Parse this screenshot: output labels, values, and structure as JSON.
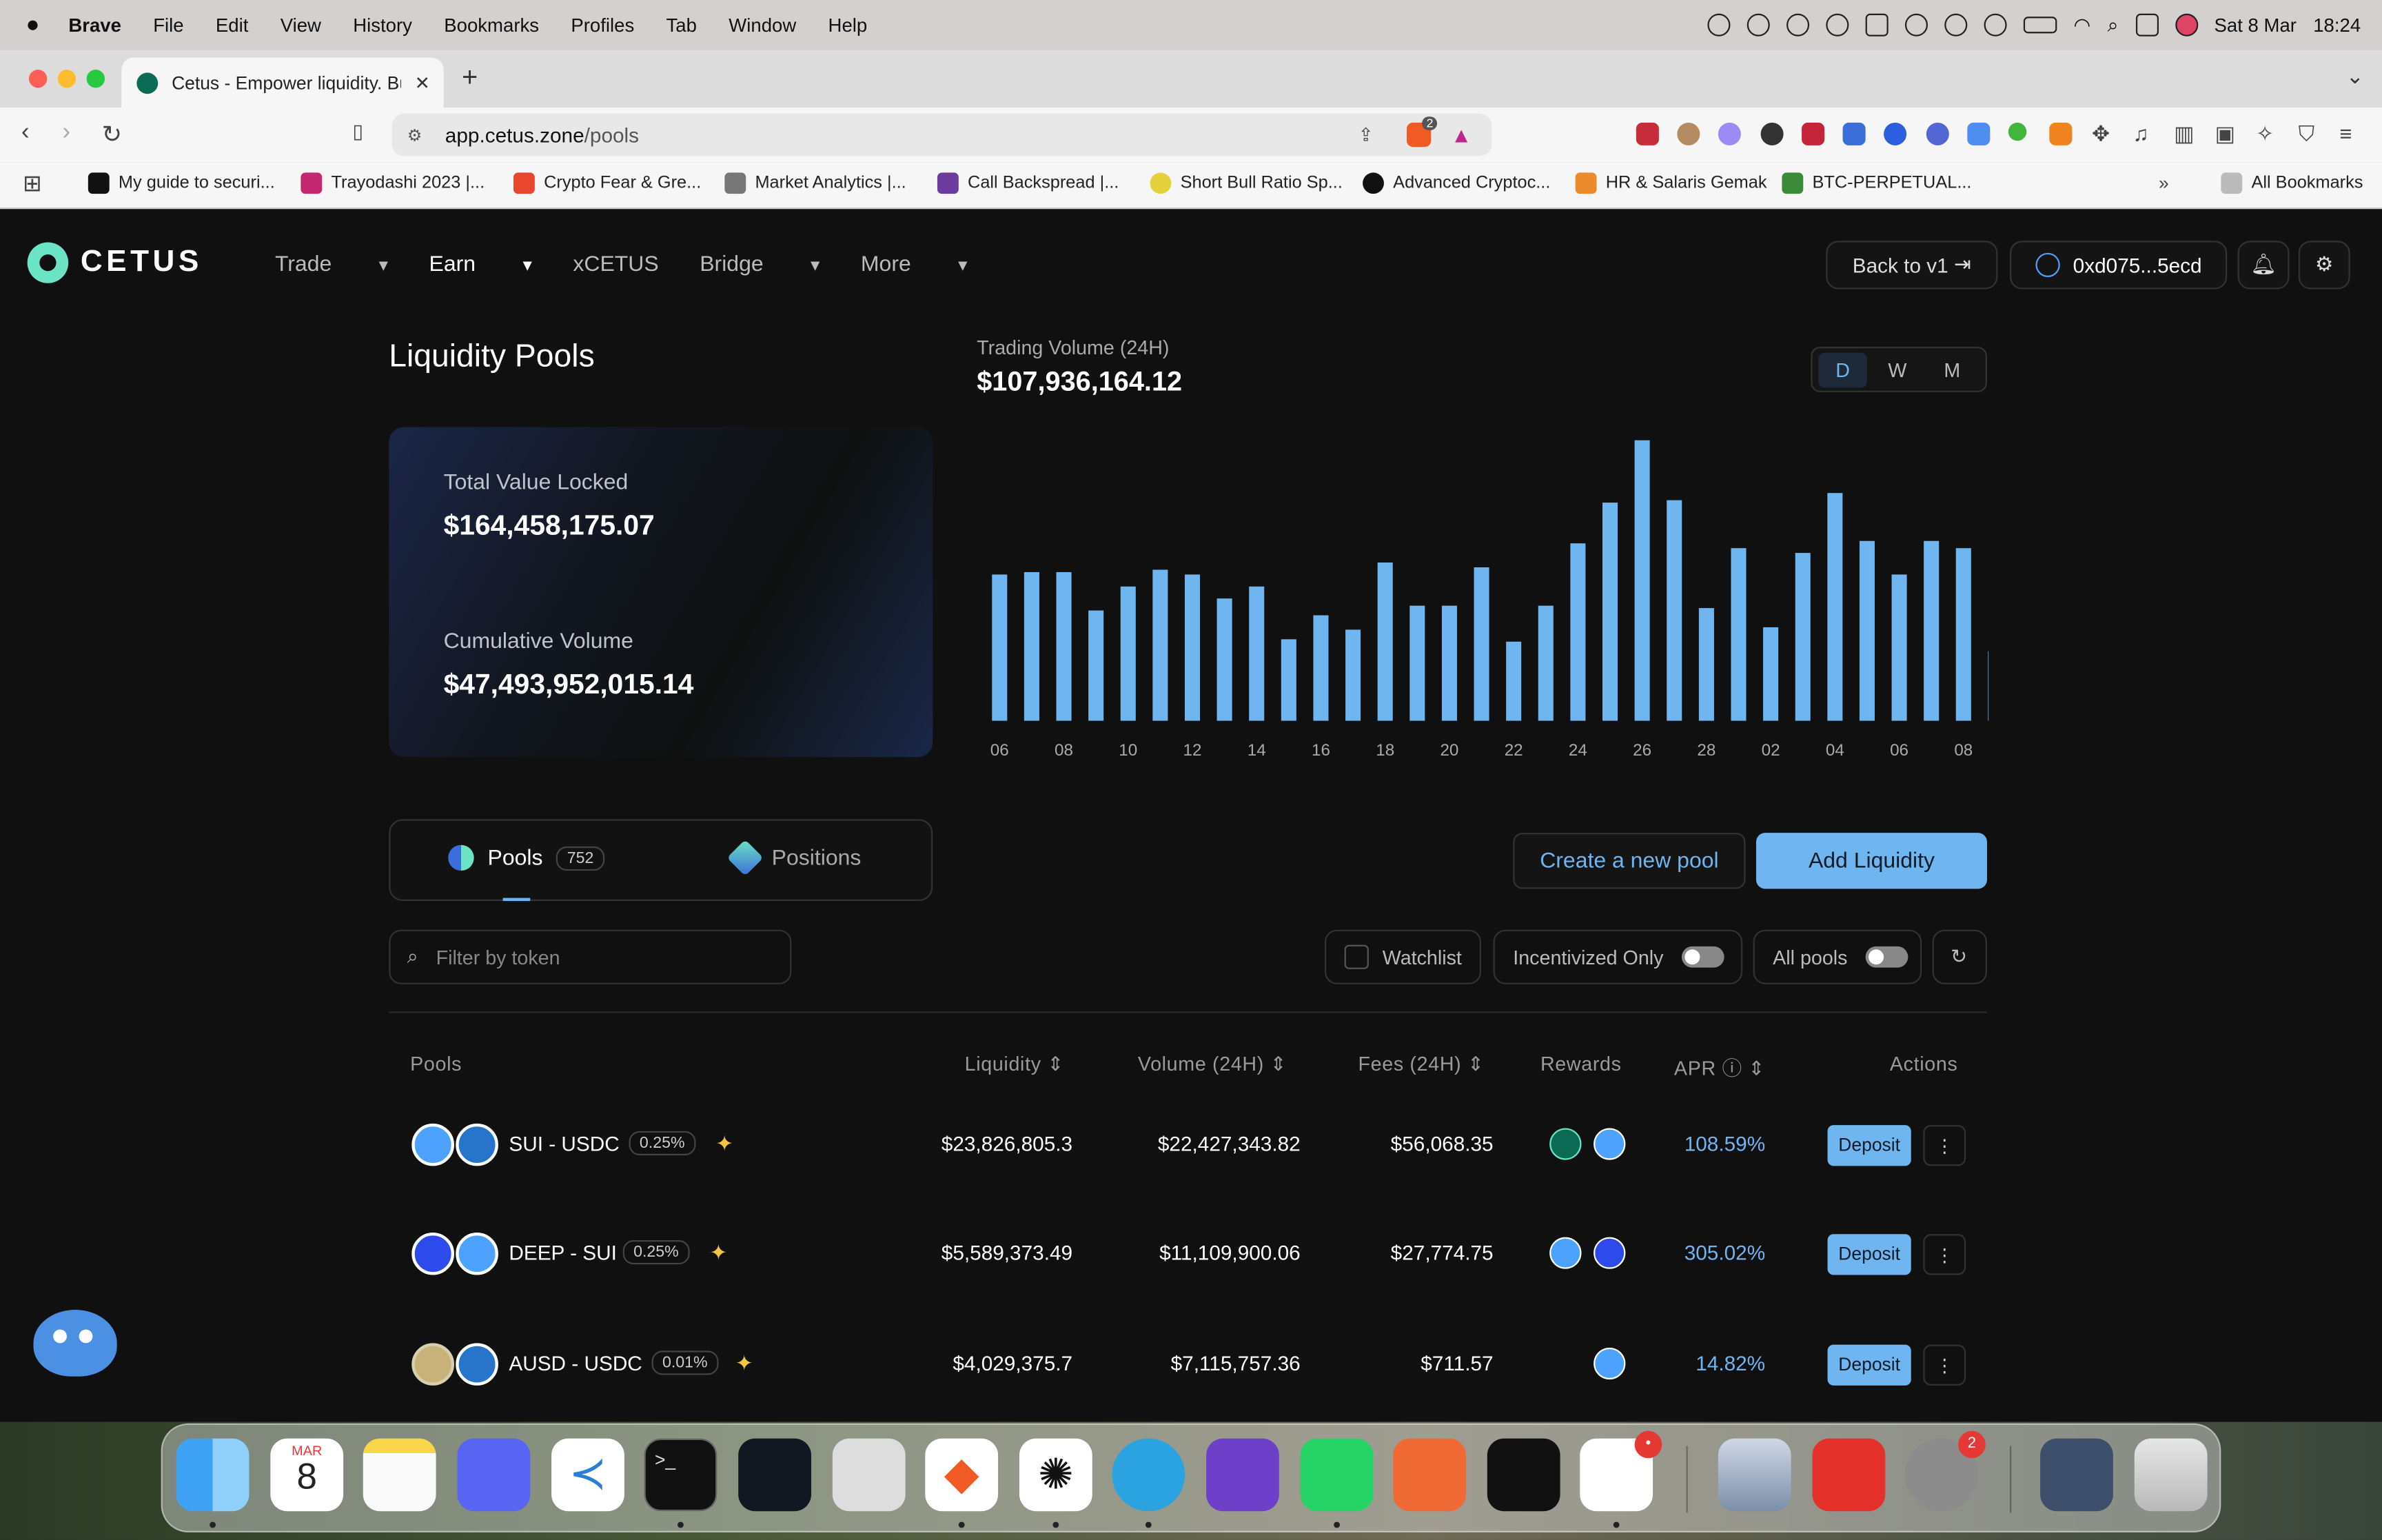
{
  "menubar": {
    "browser": "Brave",
    "items": [
      "File",
      "Edit",
      "View",
      "History",
      "Bookmarks",
      "Profiles",
      "Tab",
      "Window",
      "Help"
    ],
    "date": "Sat 8 Mar",
    "time": "18:24"
  },
  "browser": {
    "tab_title": "Cetus - Empower liquidity. Bu",
    "url_domain": "app.cetus.zone",
    "url_path": "/pools",
    "shield_count": "2",
    "bookmarks": [
      "My guide to securi...",
      "Trayodashi 2023 |...",
      "Crypto Fear & Gre...",
      "Market Analytics |...",
      "Call Backspread |...",
      "Short Bull Ratio Sp...",
      "Advanced Cryptoc...",
      "HR & Salaris Gemak",
      "BTC-PERPETUAL..."
    ],
    "all_bookmarks": "All Bookmarks"
  },
  "nav": {
    "logo": "CETUS",
    "items": [
      "Trade",
      "Earn",
      "xCETUS",
      "Bridge",
      "More"
    ],
    "back_v1": "Back to v1",
    "wallet": "0xd075...5ecd"
  },
  "page": {
    "title": "Liquidity Pools",
    "tvl_label": "Total Value Locked",
    "tvl_value": "$164,458,175.07",
    "cum_label": "Cumulative Volume",
    "cum_value": "$47,493,952,015.14"
  },
  "volume": {
    "label": "Trading Volume (24H)",
    "value": "$107,936,164.12",
    "periods": [
      "D",
      "W",
      "M"
    ],
    "active_period": "D"
  },
  "chart_data": {
    "type": "bar",
    "x_ticks": [
      "06",
      "08",
      "10",
      "12",
      "14",
      "16",
      "18",
      "20",
      "22",
      "24",
      "26",
      "28",
      "02",
      "04",
      "06",
      "08"
    ],
    "values": [
      61,
      62,
      62,
      46,
      56,
      63,
      61,
      51,
      56,
      34,
      44,
      38,
      66,
      48,
      48,
      64,
      33,
      48,
      74,
      91,
      117,
      92,
      47,
      72,
      39,
      70,
      95,
      75,
      61,
      75,
      72,
      29
    ],
    "color": "#6fb6f1",
    "ylim": [
      0,
      120
    ]
  },
  "tabs": {
    "pools": "Pools",
    "pools_count": "752",
    "positions": "Positions"
  },
  "actions": {
    "create_pool": "Create a new pool",
    "add_liquidity": "Add Liquidity"
  },
  "filters": {
    "search_placeholder": "Filter by token",
    "watchlist": "Watchlist",
    "incentivized": "Incentivized Only",
    "all_pools": "All pools"
  },
  "table": {
    "headers": {
      "pools": "Pools",
      "liquidity": "Liquidity",
      "volume": "Volume (24H)",
      "fees": "Fees (24H)",
      "rewards": "Rewards",
      "apr": "APR",
      "actions": "Actions"
    },
    "deposit_label": "Deposit",
    "rows": [
      {
        "pair": "SUI - USDC",
        "fee": "0.25%",
        "liquidity": "$23,826,805.3",
        "volume": "$22,427,343.82",
        "fees": "$56,068.35",
        "apr": "108.59%",
        "t1": "#4da2ff",
        "t2": "#2775ca"
      },
      {
        "pair": "DEEP - SUI",
        "fee": "0.25%",
        "liquidity": "$5,589,373.49",
        "volume": "$11,109,900.06",
        "fees": "$27,774.75",
        "apr": "305.02%",
        "t1": "#2c4bea",
        "t2": "#4da2ff"
      },
      {
        "pair": "AUSD - USDC",
        "fee": "0.01%",
        "liquidity": "$4,029,375.7",
        "volume": "$7,115,757.36",
        "fees": "$711.57",
        "apr": "14.82%",
        "t1": "#c8b27a",
        "t2": "#2775ca"
      }
    ]
  },
  "dock": {
    "calendar_month": "MAR",
    "calendar_day": "8",
    "badge_slack": "•",
    "badge_settings": "2"
  }
}
